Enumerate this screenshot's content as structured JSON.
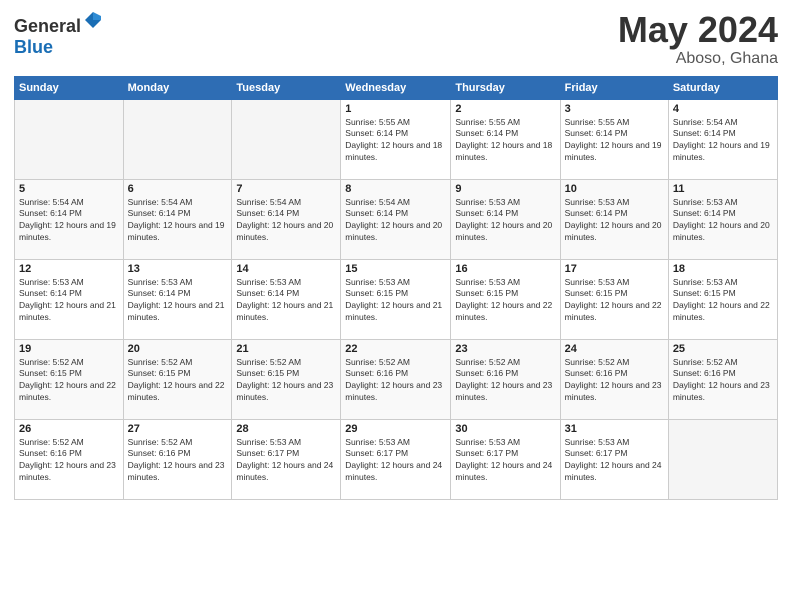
{
  "header": {
    "logo_general": "General",
    "logo_blue": "Blue",
    "month": "May 2024",
    "location": "Aboso, Ghana"
  },
  "weekdays": [
    "Sunday",
    "Monday",
    "Tuesday",
    "Wednesday",
    "Thursday",
    "Friday",
    "Saturday"
  ],
  "weeks": [
    [
      {
        "day": "",
        "sunrise": "",
        "sunset": "",
        "daylight": ""
      },
      {
        "day": "",
        "sunrise": "",
        "sunset": "",
        "daylight": ""
      },
      {
        "day": "",
        "sunrise": "",
        "sunset": "",
        "daylight": ""
      },
      {
        "day": "1",
        "sunrise": "Sunrise: 5:55 AM",
        "sunset": "Sunset: 6:14 PM",
        "daylight": "Daylight: 12 hours and 18 minutes."
      },
      {
        "day": "2",
        "sunrise": "Sunrise: 5:55 AM",
        "sunset": "Sunset: 6:14 PM",
        "daylight": "Daylight: 12 hours and 18 minutes."
      },
      {
        "day": "3",
        "sunrise": "Sunrise: 5:55 AM",
        "sunset": "Sunset: 6:14 PM",
        "daylight": "Daylight: 12 hours and 19 minutes."
      },
      {
        "day": "4",
        "sunrise": "Sunrise: 5:54 AM",
        "sunset": "Sunset: 6:14 PM",
        "daylight": "Daylight: 12 hours and 19 minutes."
      }
    ],
    [
      {
        "day": "5",
        "sunrise": "Sunrise: 5:54 AM",
        "sunset": "Sunset: 6:14 PM",
        "daylight": "Daylight: 12 hours and 19 minutes."
      },
      {
        "day": "6",
        "sunrise": "Sunrise: 5:54 AM",
        "sunset": "Sunset: 6:14 PM",
        "daylight": "Daylight: 12 hours and 19 minutes."
      },
      {
        "day": "7",
        "sunrise": "Sunrise: 5:54 AM",
        "sunset": "Sunset: 6:14 PM",
        "daylight": "Daylight: 12 hours and 20 minutes."
      },
      {
        "day": "8",
        "sunrise": "Sunrise: 5:54 AM",
        "sunset": "Sunset: 6:14 PM",
        "daylight": "Daylight: 12 hours and 20 minutes."
      },
      {
        "day": "9",
        "sunrise": "Sunrise: 5:53 AM",
        "sunset": "Sunset: 6:14 PM",
        "daylight": "Daylight: 12 hours and 20 minutes."
      },
      {
        "day": "10",
        "sunrise": "Sunrise: 5:53 AM",
        "sunset": "Sunset: 6:14 PM",
        "daylight": "Daylight: 12 hours and 20 minutes."
      },
      {
        "day": "11",
        "sunrise": "Sunrise: 5:53 AM",
        "sunset": "Sunset: 6:14 PM",
        "daylight": "Daylight: 12 hours and 20 minutes."
      }
    ],
    [
      {
        "day": "12",
        "sunrise": "Sunrise: 5:53 AM",
        "sunset": "Sunset: 6:14 PM",
        "daylight": "Daylight: 12 hours and 21 minutes."
      },
      {
        "day": "13",
        "sunrise": "Sunrise: 5:53 AM",
        "sunset": "Sunset: 6:14 PM",
        "daylight": "Daylight: 12 hours and 21 minutes."
      },
      {
        "day": "14",
        "sunrise": "Sunrise: 5:53 AM",
        "sunset": "Sunset: 6:14 PM",
        "daylight": "Daylight: 12 hours and 21 minutes."
      },
      {
        "day": "15",
        "sunrise": "Sunrise: 5:53 AM",
        "sunset": "Sunset: 6:15 PM",
        "daylight": "Daylight: 12 hours and 21 minutes."
      },
      {
        "day": "16",
        "sunrise": "Sunrise: 5:53 AM",
        "sunset": "Sunset: 6:15 PM",
        "daylight": "Daylight: 12 hours and 22 minutes."
      },
      {
        "day": "17",
        "sunrise": "Sunrise: 5:53 AM",
        "sunset": "Sunset: 6:15 PM",
        "daylight": "Daylight: 12 hours and 22 minutes."
      },
      {
        "day": "18",
        "sunrise": "Sunrise: 5:53 AM",
        "sunset": "Sunset: 6:15 PM",
        "daylight": "Daylight: 12 hours and 22 minutes."
      }
    ],
    [
      {
        "day": "19",
        "sunrise": "Sunrise: 5:52 AM",
        "sunset": "Sunset: 6:15 PM",
        "daylight": "Daylight: 12 hours and 22 minutes."
      },
      {
        "day": "20",
        "sunrise": "Sunrise: 5:52 AM",
        "sunset": "Sunset: 6:15 PM",
        "daylight": "Daylight: 12 hours and 22 minutes."
      },
      {
        "day": "21",
        "sunrise": "Sunrise: 5:52 AM",
        "sunset": "Sunset: 6:15 PM",
        "daylight": "Daylight: 12 hours and 23 minutes."
      },
      {
        "day": "22",
        "sunrise": "Sunrise: 5:52 AM",
        "sunset": "Sunset: 6:16 PM",
        "daylight": "Daylight: 12 hours and 23 minutes."
      },
      {
        "day": "23",
        "sunrise": "Sunrise: 5:52 AM",
        "sunset": "Sunset: 6:16 PM",
        "daylight": "Daylight: 12 hours and 23 minutes."
      },
      {
        "day": "24",
        "sunrise": "Sunrise: 5:52 AM",
        "sunset": "Sunset: 6:16 PM",
        "daylight": "Daylight: 12 hours and 23 minutes."
      },
      {
        "day": "25",
        "sunrise": "Sunrise: 5:52 AM",
        "sunset": "Sunset: 6:16 PM",
        "daylight": "Daylight: 12 hours and 23 minutes."
      }
    ],
    [
      {
        "day": "26",
        "sunrise": "Sunrise: 5:52 AM",
        "sunset": "Sunset: 6:16 PM",
        "daylight": "Daylight: 12 hours and 23 minutes."
      },
      {
        "day": "27",
        "sunrise": "Sunrise: 5:52 AM",
        "sunset": "Sunset: 6:16 PM",
        "daylight": "Daylight: 12 hours and 23 minutes."
      },
      {
        "day": "28",
        "sunrise": "Sunrise: 5:53 AM",
        "sunset": "Sunset: 6:17 PM",
        "daylight": "Daylight: 12 hours and 24 minutes."
      },
      {
        "day": "29",
        "sunrise": "Sunrise: 5:53 AM",
        "sunset": "Sunset: 6:17 PM",
        "daylight": "Daylight: 12 hours and 24 minutes."
      },
      {
        "day": "30",
        "sunrise": "Sunrise: 5:53 AM",
        "sunset": "Sunset: 6:17 PM",
        "daylight": "Daylight: 12 hours and 24 minutes."
      },
      {
        "day": "31",
        "sunrise": "Sunrise: 5:53 AM",
        "sunset": "Sunset: 6:17 PM",
        "daylight": "Daylight: 12 hours and 24 minutes."
      },
      {
        "day": "",
        "sunrise": "",
        "sunset": "",
        "daylight": ""
      }
    ]
  ]
}
